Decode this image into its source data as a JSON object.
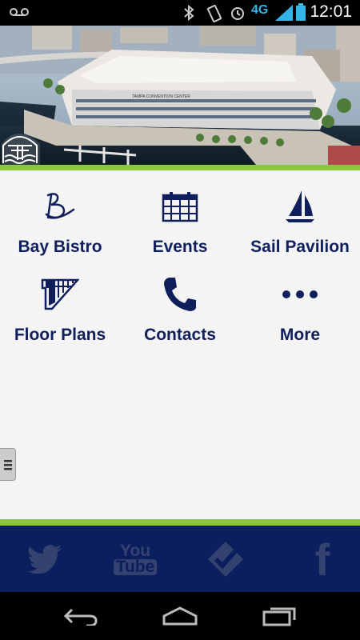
{
  "status_bar": {
    "time": "12:01",
    "network": "4G",
    "icons": [
      "voicemail-icon",
      "bluetooth-icon",
      "vibrate-icon",
      "alarm-icon",
      "network-4g-icon",
      "signal-icon",
      "battery-icon"
    ]
  },
  "hero": {
    "building_sign": "TAMPA CONVENTION CENTER"
  },
  "menu": {
    "items": [
      {
        "label": "Bay Bistro",
        "icon": "bay-bistro-logo-icon"
      },
      {
        "label": "Events",
        "icon": "calendar-icon"
      },
      {
        "label": "Sail Pavilion",
        "icon": "sailboat-icon"
      },
      {
        "label": "Floor Plans",
        "icon": "floor-plan-icon"
      },
      {
        "label": "Contacts",
        "icon": "phone-icon"
      },
      {
        "label": "More",
        "icon": "more-dots-icon"
      }
    ]
  },
  "social": {
    "items": [
      "twitter-icon",
      "youtube-icon",
      "foursquare-icon",
      "facebook-icon"
    ],
    "youtube_text": [
      "You",
      "Tube"
    ],
    "facebook_text": "f"
  },
  "colors": {
    "accent_green": "#8dc63f",
    "navy": "#0b1f5f",
    "label_navy": "#0f1f5c",
    "icon_gray": "#2f3e75"
  }
}
